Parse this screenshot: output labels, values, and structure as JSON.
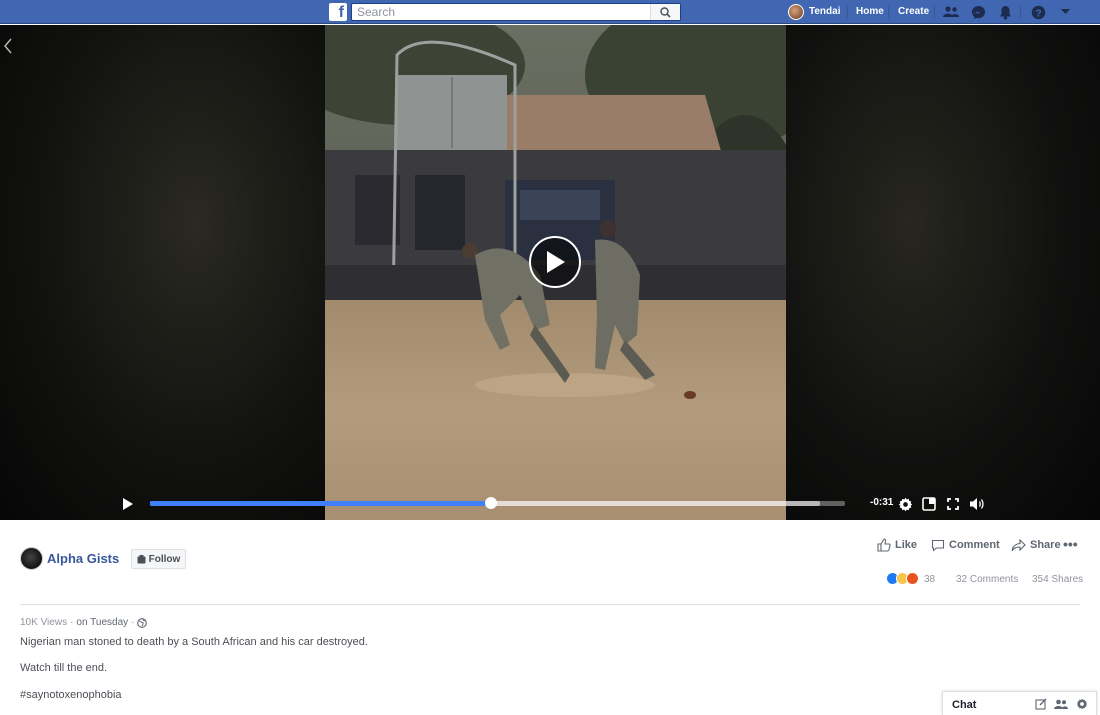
{
  "topbar": {
    "logo_letter": "f",
    "search_placeholder": "Search",
    "user_name": "Tendai",
    "home_label": "Home",
    "create_label": "Create",
    "icons": [
      "friends-icon",
      "messenger-icon",
      "notifications-icon",
      "help-icon",
      "dropdown-arrow-icon"
    ],
    "brand_color": "#4267b2"
  },
  "video": {
    "time_remaining": "-0:31",
    "progress": 0.49,
    "buffered": 0.964,
    "accent_color": "#4080ff"
  },
  "post": {
    "page_name": "Alpha Gists",
    "follow_label": "Follow",
    "actions": {
      "like": "Like",
      "comment": "Comment",
      "share": "Share"
    },
    "reaction_count": "38",
    "reactions": [
      "like",
      "sad",
      "angry"
    ],
    "comments": "32 Comments",
    "shares": "354 Shares",
    "views": "10K Views",
    "meta_sep": "·",
    "time": "on Tuesday",
    "description": [
      "Nigerian man stoned to death by a South African and his car destroyed.",
      "Watch till the end.",
      "#saynotoxenophobia"
    ]
  },
  "chat": {
    "label": "Chat"
  }
}
